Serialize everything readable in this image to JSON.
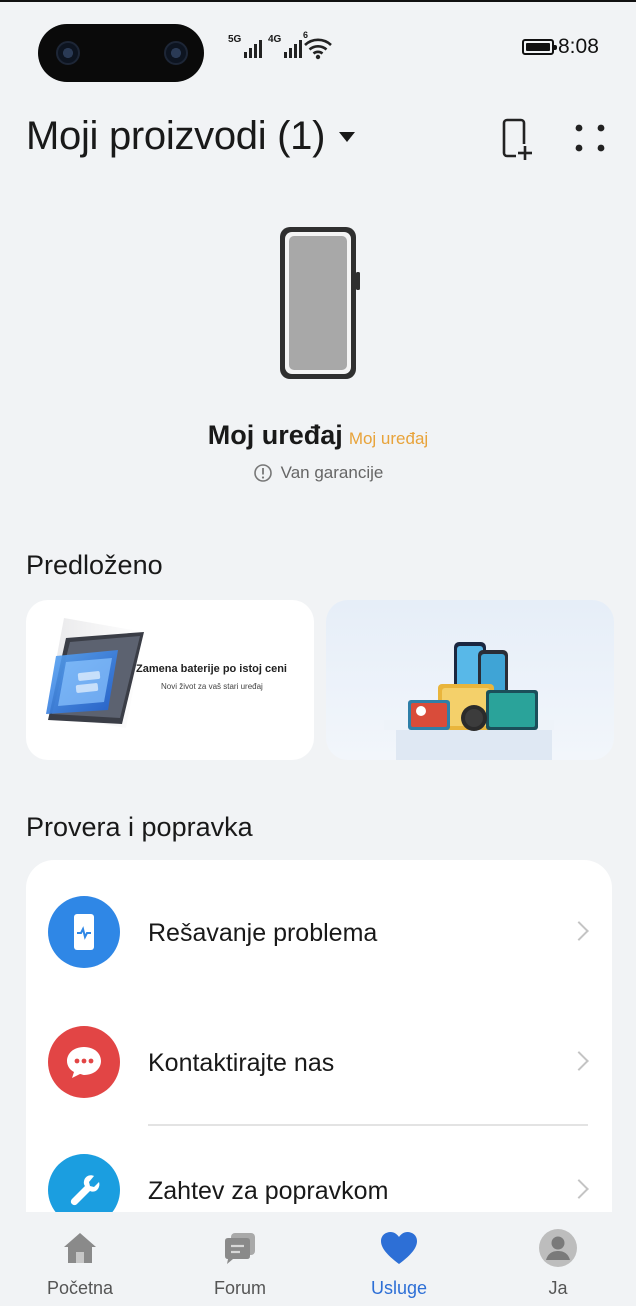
{
  "status_bar": {
    "network_1": "5G",
    "network_2": "4G",
    "wifi_tag": "6",
    "time": "8:08",
    "battery_level": 1.0
  },
  "header": {
    "title": "Moji proizvodi (1)"
  },
  "device": {
    "name": "Moj uređaj",
    "tag": "Moj uređaj",
    "warranty_status": "Van garancije"
  },
  "suggested": {
    "title": "Predloženo",
    "cards": [
      {
        "title": "Zamena baterije po istoj ceni",
        "subtitle": "Novi život za vaš stari uređaj"
      },
      {
        "title": "",
        "subtitle": ""
      }
    ]
  },
  "repair": {
    "title": "Provera i popravka",
    "items": [
      {
        "label": "Rešavanje problema",
        "icon": "phone-diagnose-icon",
        "color": "#2f87e6"
      },
      {
        "label": "Kontaktirajte nas",
        "icon": "chat-bubble-icon",
        "color": "#e24545"
      },
      {
        "label": "Zahtev za popravkom",
        "icon": "wrench-icon",
        "color": "#1b9ee0"
      }
    ]
  },
  "bottom_nav": {
    "items": [
      {
        "label": "Početna",
        "icon": "home-icon"
      },
      {
        "label": "Forum",
        "icon": "forum-icon"
      },
      {
        "label": "Usluge",
        "icon": "heart-icon",
        "active": true
      },
      {
        "label": "Ja",
        "icon": "profile-icon"
      }
    ]
  },
  "colors": {
    "accent": "#2d6fd6",
    "tag": "#e8a33a",
    "background": "#f1f3f5"
  }
}
